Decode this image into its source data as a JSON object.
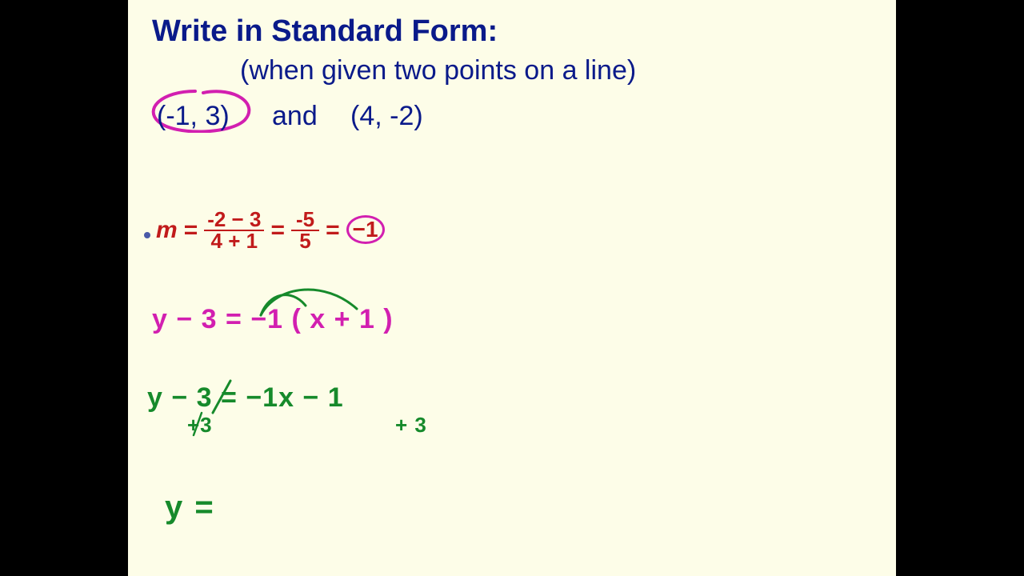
{
  "title": "Write in Standard Form:",
  "subtitle": "(when given two points on a line)",
  "points": {
    "p1": "(-1, 3)",
    "and": "and",
    "p2": "(4, -2)"
  },
  "slope": {
    "m": "m",
    "eq": "=",
    "num1": "-2 − 3",
    "den1": "4 + 1",
    "num2": "-5",
    "den2": "5",
    "result": "−1"
  },
  "pointslope": "y − 3 = −1 ( x + 1 )",
  "dist": {
    "row1": "y − 3 = −1x − 1",
    "plus3a": "+3",
    "plus3b": "+ 3"
  },
  "yeq": "y ="
}
